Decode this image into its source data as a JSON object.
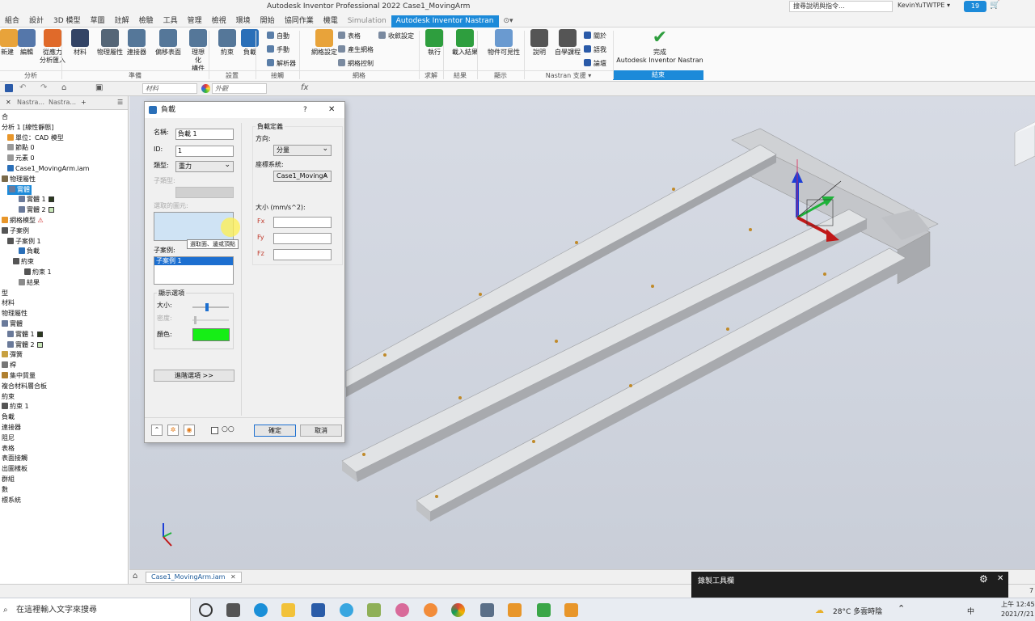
{
  "window": {
    "app_title": "Autodesk Inventor Professional 2022   Case1_MovingArm",
    "help_search": "搜尋說明與指令...",
    "user": "KevinYuTWTPE ▾",
    "clock_badge": "19",
    "menu_tabs": [
      "組合",
      "設計",
      "3D 模型",
      "草圖",
      "註解",
      "檢驗",
      "工具",
      "管理",
      "檢視",
      "環境",
      "開始",
      "協同作業",
      "機電",
      "Simulation",
      "Autodesk Inventor Nastran",
      "⊙▾"
    ]
  },
  "ribbon": {
    "buttons": [
      {
        "label": "新建",
        "color": "#e8a33a"
      },
      {
        "label": "編輯",
        "color": "#5577aa"
      },
      {
        "label": "從應力\n分析匯入",
        "color": "#e06a2a"
      },
      {
        "label": "材料",
        "color": "#334466"
      },
      {
        "label": "物理屬性",
        "color": "#556677"
      },
      {
        "label": "連接器",
        "color": "#557799"
      },
      {
        "label": "偏移表面",
        "color": "#557799"
      },
      {
        "label": "理想化\n構件",
        "color": "#557799"
      },
      {
        "label": "約束",
        "color": "#557799"
      },
      {
        "label": "負載",
        "color": "#2a6fb8"
      },
      {
        "label": "網格設定",
        "color": "#e8a33a"
      },
      {
        "label": "執行",
        "color": "#2e9e3e"
      },
      {
        "label": "載入結果",
        "color": "#2e9e3e"
      },
      {
        "label": "物件可見性",
        "color": "#6a9ad0"
      },
      {
        "label": "說明",
        "color": "#555555"
      },
      {
        "label": "自學課程",
        "color": "#555555"
      },
      {
        "label": "完成\nAutodesk Inventor Nastran",
        "color": "#2e9e3e"
      }
    ],
    "small_buttons": {
      "contact": [
        "自動",
        "手動",
        "解析器"
      ],
      "mesh": [
        "表格",
        "產生網格",
        "網格控制",
        "收斂設定"
      ],
      "support": [
        "關於",
        "語我",
        "論壇"
      ]
    },
    "groups": [
      "分析",
      "準備",
      "設置",
      "接觸",
      "網格",
      "求解",
      "結果",
      "顯示",
      "Nastran 支援 ▾",
      "結束"
    ]
  },
  "quick_access": {
    "material": "材料",
    "appearance": "外觀"
  },
  "browser": {
    "tabs": [
      "Nastra...",
      "Nastra..."
    ],
    "items": [
      {
        "label": "合",
        "indent": 0,
        "icon": "none"
      },
      {
        "label": "分析 1 [線性靜態]",
        "indent": 0,
        "icon": "none"
      },
      {
        "label": "單位：CAD 模型",
        "indent": 1,
        "icon": "unit"
      },
      {
        "label": "節點 0",
        "indent": 1,
        "icon": "dot"
      },
      {
        "label": "元素 0",
        "indent": 1,
        "icon": "dot"
      },
      {
        "label": "Case1_MovingArm.iam",
        "indent": 1,
        "icon": "doc"
      },
      {
        "label": "物理屬性",
        "indent": 0,
        "icon": "prop"
      },
      {
        "label": "實體",
        "indent": 1,
        "icon": "solid",
        "selected": true
      },
      {
        "label": "實體 1",
        "indent": 3,
        "icon": "solid",
        "swatch": "#2b3a1e"
      },
      {
        "label": "實體 2",
        "indent": 3,
        "icon": "solid",
        "swatch": "#c8e6b8"
      },
      {
        "label": "網格模型",
        "indent": 0,
        "icon": "mesh",
        "warning": true
      },
      {
        "label": "子案例",
        "indent": 0,
        "icon": "case"
      },
      {
        "label": "子案例 1",
        "indent": 1,
        "icon": "case"
      },
      {
        "label": "負載",
        "indent": 3,
        "icon": "load"
      },
      {
        "label": "約束",
        "indent": 2,
        "icon": "constraint"
      },
      {
        "label": "約束 1",
        "indent": 4,
        "icon": "constraint"
      },
      {
        "label": "結果",
        "indent": 3,
        "icon": "result"
      },
      {
        "label": "型",
        "indent": 0,
        "icon": "none"
      },
      {
        "label": "材料",
        "indent": 0,
        "icon": "none"
      },
      {
        "label": "物理屬性",
        "indent": 0,
        "icon": "none"
      },
      {
        "label": "實體",
        "indent": 0,
        "icon": "solid"
      },
      {
        "label": "實體 1",
        "indent": 1,
        "icon": "solid",
        "swatch": "#2b3a1e"
      },
      {
        "label": "實體 2",
        "indent": 1,
        "icon": "solid",
        "swatch": "#c8e6b8"
      },
      {
        "label": "彈簧",
        "indent": 0,
        "icon": "spring"
      },
      {
        "label": "桿",
        "indent": 0,
        "icon": "bar"
      },
      {
        "label": "集中質量",
        "indent": 0,
        "icon": "mass"
      },
      {
        "label": "複合材料層合板",
        "indent": 0,
        "icon": "none"
      },
      {
        "label": "約束",
        "indent": 0,
        "icon": "none"
      },
      {
        "label": "約束 1",
        "indent": 0,
        "icon": "constraint"
      },
      {
        "label": "負載",
        "indent": 0,
        "icon": "none"
      },
      {
        "label": "連接器",
        "indent": 0,
        "icon": "none"
      },
      {
        "label": "阻尼",
        "indent": 0,
        "icon": "none"
      },
      {
        "label": "表格",
        "indent": 0,
        "icon": "none"
      },
      {
        "label": "表面接觸",
        "indent": 0,
        "icon": "none"
      },
      {
        "label": "出圖樣板",
        "indent": 0,
        "icon": "none"
      },
      {
        "label": "群組",
        "indent": 0,
        "icon": "none"
      },
      {
        "label": "數",
        "indent": 0,
        "icon": "none"
      },
      {
        "label": "標系統",
        "indent": 0,
        "icon": "none"
      }
    ]
  },
  "dialog": {
    "title": "負載",
    "help": "?",
    "close": "✕",
    "name_label": "名稱:",
    "name_value": "負載 1",
    "id_label": "ID:",
    "id_value": "1",
    "type_label": "類型:",
    "type_value": "重力",
    "subtype_label": "子類型:",
    "selected_entities_label": "選取的圖元:",
    "tooltip": "選取面、邊或頂點",
    "subcase_label": "子案例:",
    "subcase_item": "子案例 1",
    "display_options_label": "顯示選項",
    "size_label": "大小:",
    "density_label": "密度:",
    "color_label": "顏色:",
    "color_value": "#16ee16",
    "size_slider": 0.4,
    "density_slider": 0.05,
    "advanced_button": "進階選項 >>",
    "load_def_label": "負載定義",
    "direction_label": "方向:",
    "direction_value": "分量",
    "coord_label": "座標系統:",
    "coord_value": "Case1_MovingA",
    "magnitude_label": "大小 (mm/s^2):",
    "fx_label": "Fx",
    "fy_label": "Fy",
    "fz_label": "Fz",
    "ok_button": "確定",
    "cancel_button": "取消"
  },
  "document_tab": "Case1_MovingArm.iam",
  "recording_toolbar": {
    "title": "錄製工具欄"
  },
  "status_right": "7",
  "taskbar": {
    "search_placeholder": "在這裡輸入文字來搜尋",
    "weather": "28°C 多雲時陰",
    "ime": "中",
    "time": "上午 12:45",
    "date": "2021/7/21"
  }
}
